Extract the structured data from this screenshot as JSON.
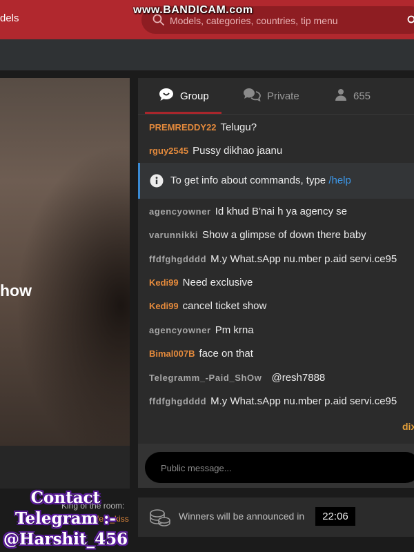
{
  "header": {
    "brand_fragment": "dels",
    "search_placeholder": "Models, categories, countries, tip menu",
    "watermark": "www.BANDICAM.com",
    "accent_color": "#b1282e"
  },
  "video": {
    "caption_fragment": "how",
    "king_label": "King of the room:",
    "king_name": "feel_kiss",
    "overlay_text": [
      "Contact",
      "Telegram :-",
      "@Harshit_456"
    ]
  },
  "chat": {
    "tabs": [
      {
        "label": "Group",
        "icon": "chat-bubble-icon",
        "active": true
      },
      {
        "label": "Private",
        "icon": "private-chat-icon",
        "active": false
      },
      {
        "label": "655",
        "icon": "user-icon",
        "active": false
      }
    ],
    "messages": [
      {
        "user": "PREMREDDY22",
        "text": "Telugu?",
        "color": "orange"
      },
      {
        "user": "rguy2545",
        "text": "Pussy dikhao jaanu",
        "color": "orange"
      },
      {
        "user": "agencyowner",
        "text": "Id khud B'nai h ya agency se",
        "color": "grey"
      },
      {
        "user": "varunnikki",
        "text": "Show a glimpse of down there baby",
        "color": "grey"
      },
      {
        "user": "ffdfghgdddd",
        "text": "M.y What.sApp nu.mber p.aid servi.ce95",
        "color": "grey"
      },
      {
        "user": "Kedi99",
        "text": "Need exclusive",
        "color": "orange"
      },
      {
        "user": "Kedi99",
        "text": "cancel ticket show",
        "color": "orange"
      },
      {
        "user": "agencyowner",
        "text": "Pm krna",
        "color": "grey"
      },
      {
        "user": "Bimal007B",
        "text": "face on that",
        "color": "orange"
      },
      {
        "user": "Telegramm_-Paid_ShOw",
        "text": "@resh7888",
        "color": "grey"
      },
      {
        "user": "ffdfghgdddd",
        "text": "M.y What.sApp nu.mber p.aid servi.ce95",
        "color": "grey"
      }
    ],
    "info_text": "To get info about commands, type",
    "info_command": "/help",
    "info_accent": "#3a8ad3",
    "footer_fragment": "dix",
    "input_placeholder": "Public message...",
    "winners_text": "Winners will be announced in",
    "timer": "22:06"
  }
}
